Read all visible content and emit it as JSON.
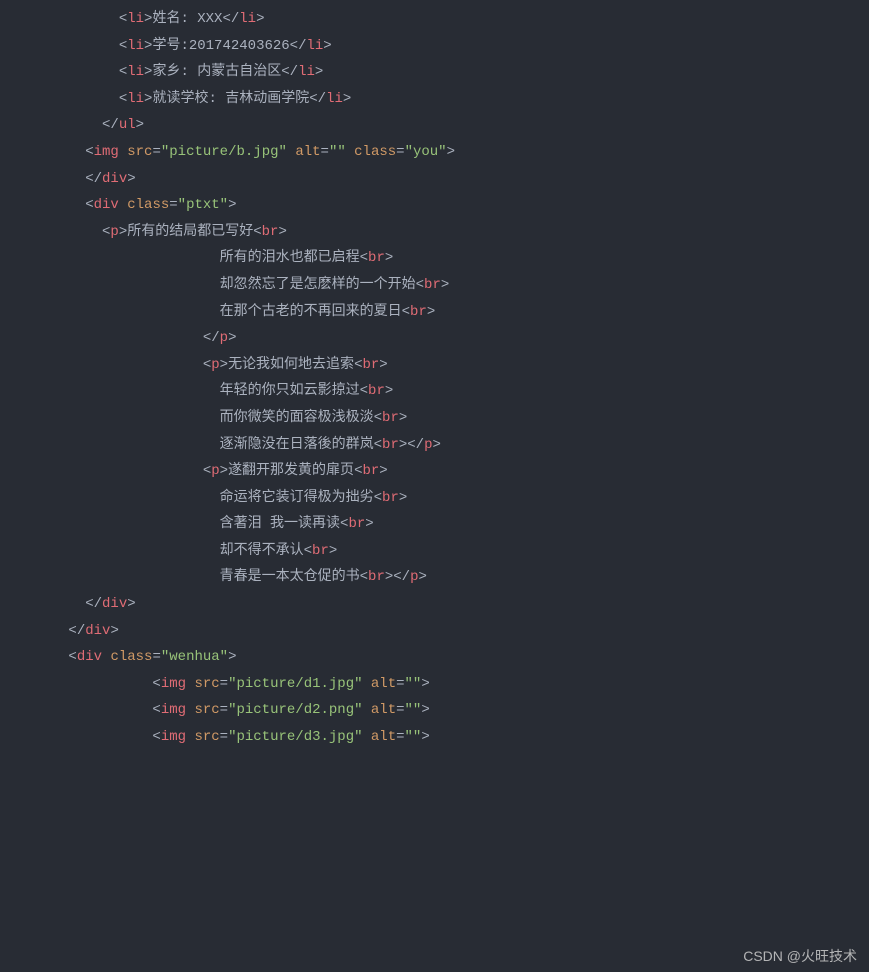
{
  "lines": [
    {
      "indent": 6,
      "tokens": [
        [
          "bracket",
          "<"
        ],
        [
          "tag-name",
          "li"
        ],
        [
          "bracket",
          ">"
        ],
        [
          "text",
          "姓名: XXX"
        ],
        [
          "bracket",
          "</"
        ],
        [
          "tag-name",
          "li"
        ],
        [
          "bracket",
          ">"
        ]
      ]
    },
    {
      "indent": 6,
      "tokens": [
        [
          "bracket",
          "<"
        ],
        [
          "tag-name",
          "li"
        ],
        [
          "bracket",
          ">"
        ],
        [
          "text",
          "学号:201742403626"
        ],
        [
          "bracket",
          "</"
        ],
        [
          "tag-name",
          "li"
        ],
        [
          "bracket",
          ">"
        ]
      ]
    },
    {
      "indent": 6,
      "tokens": [
        [
          "bracket",
          "<"
        ],
        [
          "tag-name",
          "li"
        ],
        [
          "bracket",
          ">"
        ],
        [
          "text",
          "家乡: 内蒙古自治区"
        ],
        [
          "bracket",
          "</"
        ],
        [
          "tag-name",
          "li"
        ],
        [
          "bracket",
          ">"
        ]
      ]
    },
    {
      "indent": 6,
      "tokens": [
        [
          "bracket",
          "<"
        ],
        [
          "tag-name",
          "li"
        ],
        [
          "bracket",
          ">"
        ],
        [
          "text",
          "就读学校: 吉林动画学院"
        ],
        [
          "bracket",
          "</"
        ],
        [
          "tag-name",
          "li"
        ],
        [
          "bracket",
          ">"
        ]
      ]
    },
    {
      "indent": 5,
      "tokens": [
        [
          "bracket",
          "</"
        ],
        [
          "tag-name",
          "ul"
        ],
        [
          "bracket",
          ">"
        ]
      ]
    },
    {
      "indent": 4,
      "tokens": [
        [
          "bracket",
          "<"
        ],
        [
          "tag-name",
          "img"
        ],
        [
          "text",
          " "
        ],
        [
          "attr-name",
          "src"
        ],
        [
          "punct",
          "="
        ],
        [
          "attr-value",
          "\"picture/b.jpg\""
        ],
        [
          "text",
          " "
        ],
        [
          "attr-name",
          "alt"
        ],
        [
          "punct",
          "="
        ],
        [
          "attr-value",
          "\"\""
        ],
        [
          "text",
          " "
        ],
        [
          "attr-name",
          "class"
        ],
        [
          "punct",
          "="
        ],
        [
          "attr-value",
          "\"you\""
        ],
        [
          "bracket",
          ">"
        ]
      ]
    },
    {
      "indent": 4,
      "tokens": [
        [
          "bracket",
          "</"
        ],
        [
          "tag-name",
          "div"
        ],
        [
          "bracket",
          ">"
        ]
      ]
    },
    {
      "indent": 4,
      "tokens": [
        [
          "bracket",
          "<"
        ],
        [
          "tag-name",
          "div"
        ],
        [
          "text",
          " "
        ],
        [
          "attr-name",
          "class"
        ],
        [
          "punct",
          "="
        ],
        [
          "attr-value",
          "\"ptxt\""
        ],
        [
          "bracket",
          ">"
        ]
      ]
    },
    {
      "indent": 5,
      "tokens": [
        [
          "bracket",
          "<"
        ],
        [
          "tag-name",
          "p"
        ],
        [
          "bracket",
          ">"
        ],
        [
          "text",
          "所有的结局都已写好"
        ],
        [
          "bracket",
          "<"
        ],
        [
          "tag-name",
          "br"
        ],
        [
          "bracket",
          ">"
        ]
      ]
    },
    {
      "indent": 12,
      "tokens": [
        [
          "text",
          "所有的泪水也都已启程"
        ],
        [
          "bracket",
          "<"
        ],
        [
          "tag-name",
          "br"
        ],
        [
          "bracket",
          ">"
        ]
      ]
    },
    {
      "indent": 12,
      "tokens": [
        [
          "text",
          "却忽然忘了是怎麽样的一个开始"
        ],
        [
          "bracket",
          "<"
        ],
        [
          "tag-name",
          "br"
        ],
        [
          "bracket",
          ">"
        ]
      ]
    },
    {
      "indent": 12,
      "tokens": [
        [
          "text",
          "在那个古老的不再回来的夏日"
        ],
        [
          "bracket",
          "<"
        ],
        [
          "tag-name",
          "br"
        ],
        [
          "bracket",
          ">"
        ]
      ]
    },
    {
      "indent": 11,
      "tokens": [
        [
          "bracket",
          "</"
        ],
        [
          "tag-name",
          "p"
        ],
        [
          "bracket",
          ">"
        ]
      ]
    },
    {
      "indent": 11,
      "tokens": [
        [
          "bracket",
          "<"
        ],
        [
          "tag-name",
          "p"
        ],
        [
          "bracket",
          ">"
        ],
        [
          "text",
          "无论我如何地去追索"
        ],
        [
          "bracket",
          "<"
        ],
        [
          "tag-name",
          "br"
        ],
        [
          "bracket",
          ">"
        ]
      ]
    },
    {
      "indent": 12,
      "tokens": [
        [
          "text",
          "年轻的你只如云影掠过"
        ],
        [
          "bracket",
          "<"
        ],
        [
          "tag-name",
          "br"
        ],
        [
          "bracket",
          ">"
        ]
      ]
    },
    {
      "indent": 12,
      "tokens": [
        [
          "text",
          "而你微笑的面容极浅极淡"
        ],
        [
          "bracket",
          "<"
        ],
        [
          "tag-name",
          "br"
        ],
        [
          "bracket",
          ">"
        ]
      ]
    },
    {
      "indent": 12,
      "tokens": [
        [
          "text",
          "逐渐隐没在日落後的群岚"
        ],
        [
          "bracket",
          "<"
        ],
        [
          "tag-name",
          "br"
        ],
        [
          "bracket",
          ">"
        ],
        [
          "bracket",
          "</"
        ],
        [
          "tag-name",
          "p"
        ],
        [
          "bracket",
          ">"
        ]
      ]
    },
    {
      "indent": 11,
      "tokens": [
        [
          "bracket",
          "<"
        ],
        [
          "tag-name",
          "p"
        ],
        [
          "bracket",
          ">"
        ],
        [
          "text",
          "遂翻开那发黄的扉页"
        ],
        [
          "bracket",
          "<"
        ],
        [
          "tag-name",
          "br"
        ],
        [
          "bracket",
          ">"
        ]
      ]
    },
    {
      "indent": 12,
      "tokens": [
        [
          "text",
          "命运将它装订得极为拙劣"
        ],
        [
          "bracket",
          "<"
        ],
        [
          "tag-name",
          "br"
        ],
        [
          "bracket",
          ">"
        ]
      ]
    },
    {
      "indent": 12,
      "tokens": [
        [
          "text",
          "含著泪 我一读再读"
        ],
        [
          "bracket",
          "<"
        ],
        [
          "tag-name",
          "br"
        ],
        [
          "bracket",
          ">"
        ]
      ]
    },
    {
      "indent": 12,
      "tokens": [
        [
          "text",
          "却不得不承认"
        ],
        [
          "bracket",
          "<"
        ],
        [
          "tag-name",
          "br"
        ],
        [
          "bracket",
          ">"
        ]
      ]
    },
    {
      "indent": 12,
      "tokens": [
        [
          "text",
          "青春是一本太仓促的书"
        ],
        [
          "bracket",
          "<"
        ],
        [
          "tag-name",
          "br"
        ],
        [
          "bracket",
          ">"
        ],
        [
          "bracket",
          "</"
        ],
        [
          "tag-name",
          "p"
        ],
        [
          "bracket",
          ">"
        ]
      ]
    },
    {
      "indent": 4,
      "tokens": [
        [
          "bracket",
          "</"
        ],
        [
          "tag-name",
          "div"
        ],
        [
          "bracket",
          ">"
        ]
      ]
    },
    {
      "indent": 0,
      "tokens": []
    },
    {
      "indent": 3,
      "tokens": [
        [
          "bracket",
          "</"
        ],
        [
          "tag-name",
          "div"
        ],
        [
          "bracket",
          ">"
        ]
      ]
    },
    {
      "indent": 3,
      "tokens": [
        [
          "bracket",
          "<"
        ],
        [
          "tag-name",
          "div"
        ],
        [
          "text",
          " "
        ],
        [
          "attr-name",
          "class"
        ],
        [
          "punct",
          "="
        ],
        [
          "attr-value",
          "\"wenhua\""
        ],
        [
          "bracket",
          ">"
        ]
      ]
    },
    {
      "indent": 8,
      "tokens": [
        [
          "bracket",
          "<"
        ],
        [
          "tag-name",
          "img"
        ],
        [
          "text",
          " "
        ],
        [
          "attr-name",
          "src"
        ],
        [
          "punct",
          "="
        ],
        [
          "attr-value",
          "\"picture/d1.jpg\""
        ],
        [
          "text",
          " "
        ],
        [
          "attr-name",
          "alt"
        ],
        [
          "punct",
          "="
        ],
        [
          "attr-value",
          "\"\""
        ],
        [
          "bracket",
          ">"
        ]
      ]
    },
    {
      "indent": 8,
      "tokens": [
        [
          "bracket",
          "<"
        ],
        [
          "tag-name",
          "img"
        ],
        [
          "text",
          " "
        ],
        [
          "attr-name",
          "src"
        ],
        [
          "punct",
          "="
        ],
        [
          "attr-value",
          "\"picture/d2.png\""
        ],
        [
          "text",
          " "
        ],
        [
          "attr-name",
          "alt"
        ],
        [
          "punct",
          "="
        ],
        [
          "attr-value",
          "\"\""
        ],
        [
          "bracket",
          ">"
        ]
      ]
    },
    {
      "indent": 8,
      "tokens": [
        [
          "bracket",
          "<"
        ],
        [
          "tag-name",
          "img"
        ],
        [
          "text",
          " "
        ],
        [
          "attr-name",
          "src"
        ],
        [
          "punct",
          "="
        ],
        [
          "attr-value",
          "\"picture/d3.jpg\""
        ],
        [
          "text",
          " "
        ],
        [
          "attr-name",
          "alt"
        ],
        [
          "punct",
          "="
        ],
        [
          "attr-value",
          "\"\""
        ],
        [
          "bracket",
          ">"
        ]
      ]
    }
  ],
  "watermark": "CSDN @火旺技术"
}
